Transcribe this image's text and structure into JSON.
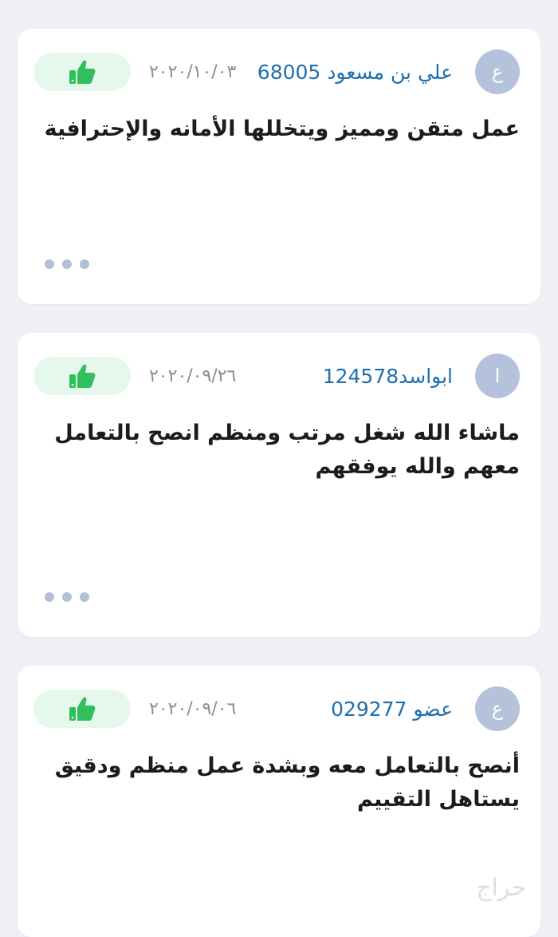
{
  "colors": {
    "background": "#eef0f6",
    "card": "#ffffff",
    "username": "#1f6fae",
    "avatar": "#b5c2db",
    "like_bg": "#e6f8ec",
    "like_icon": "#2fbf5b",
    "dots": "#b3bfd6"
  },
  "reviews": [
    {
      "avatar_letter": "ع",
      "username": "علي بن مسعود 68005",
      "date": "٢٠٢٠/١٠/٠٣",
      "text": "عمل متقن ومميز ويتخللها الأمانه والإحترافية",
      "like_icon": "thumbs-up-icon",
      "more_icon": "more-dots-icon"
    },
    {
      "avatar_letter": "ا",
      "username": "ابواسد124578",
      "date": "٢٠٢٠/٠٩/٢٦",
      "text": "ماشاء الله شغل مرتب ومنظم انصح بالتعامل معهم والله يوفقهم",
      "like_icon": "thumbs-up-icon",
      "more_icon": "more-dots-icon"
    },
    {
      "avatar_letter": "ع",
      "username": "عضو 029277",
      "date": "٢٠٢٠/٠٩/٠٦",
      "text": "أنصح بالتعامل معه وبشدة عمل منظم ودقيق يستاهل التقييم",
      "like_icon": "thumbs-up-icon",
      "more_icon": "more-dots-icon"
    }
  ],
  "watermark": "حراج"
}
